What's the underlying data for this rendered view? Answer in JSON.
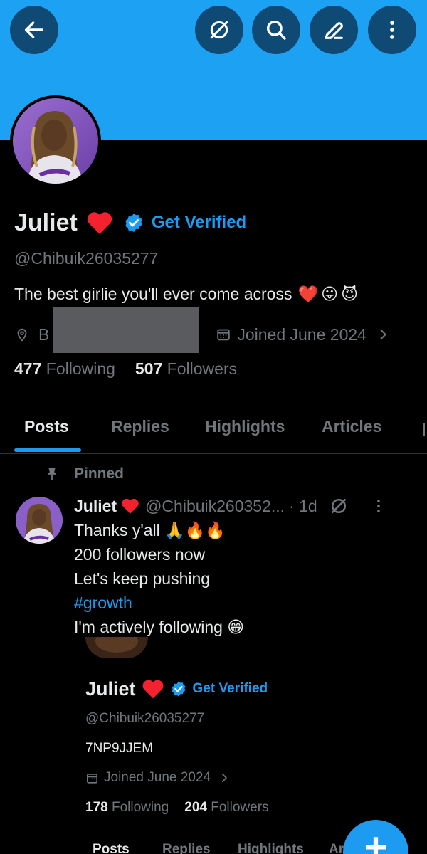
{
  "header": {
    "back_icon": "arrow-left-icon",
    "grok_icon": "slash-circle-icon",
    "search_icon": "search-icon",
    "edit_icon": "pencil-icon",
    "more_icon": "more-vertical-icon",
    "banner_color": "#1da1f2"
  },
  "profile": {
    "name": "Juliet",
    "get_verified": "Get Verified",
    "handle": "@Chibuik26035277",
    "bio": "The best girlie you'll ever come across",
    "bio_emojis": [
      "❤️",
      "😛",
      "😈"
    ],
    "location_prefix": "B",
    "joined": "Joined June 2024",
    "following_count": "477",
    "following_label": "Following",
    "followers_count": "507",
    "followers_label": "Followers"
  },
  "tabs": [
    {
      "label": "Posts"
    },
    {
      "label": "Replies"
    },
    {
      "label": "Highlights"
    },
    {
      "label": "Articles"
    }
  ],
  "pinned_post": {
    "pinned_label": "Pinned",
    "author": "Juliet",
    "handle": "@Chibuik260352...",
    "time": "· 1d",
    "lines": [
      "Thanks y'all 🙏🔥🔥",
      "200 followers now",
      "Let's keep pushing"
    ],
    "hashtag": "#growth",
    "last_line": "I'm actively following 😁",
    "embed": {
      "name": "Juliet",
      "get_verified": "Get Verified",
      "handle": "@Chibuik26035277",
      "code": "7NP9JJEM",
      "joined": "Joined June 2024",
      "following_count": "178",
      "following_label": "Following",
      "followers_count": "204",
      "followers_label": "Followers",
      "tabs": [
        "Posts",
        "Replies",
        "Highlights",
        "Ar"
      ]
    }
  },
  "fab": {
    "label": "+"
  }
}
